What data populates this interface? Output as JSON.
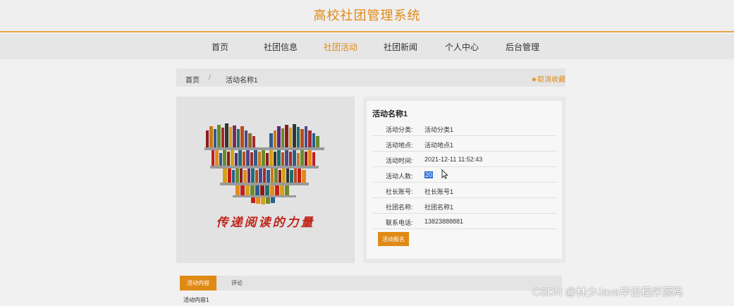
{
  "header": {
    "site_title": "高校社团管理系统"
  },
  "nav": [
    {
      "label": "首页"
    },
    {
      "label": "社团信息"
    },
    {
      "label": "社团活动"
    },
    {
      "label": "社团新闻"
    },
    {
      "label": "个人中心"
    },
    {
      "label": "后台管理"
    }
  ],
  "nav_active": "社团活动",
  "breadcrumb": {
    "home": "首页",
    "separator": "/",
    "current": "活动名称1"
  },
  "favorite": {
    "label": "取消收藏",
    "icon": "star-icon"
  },
  "image": {
    "slogan": "传递阅读的力量"
  },
  "activity": {
    "title": "活动名称1",
    "fields": [
      {
        "label": "活动分类:",
        "value": "活动分类1"
      },
      {
        "label": "活动地点:",
        "value": "活动地点1"
      },
      {
        "label": "活动时间:",
        "value": "2021-12-11 11:52:43"
      },
      {
        "label": "活动人数:",
        "value": "20"
      },
      {
        "label": "社长账号:",
        "value": "社长账号1"
      },
      {
        "label": "社团名称:",
        "value": "社团名称1"
      },
      {
        "label": "联系电话:",
        "value": "13823888881"
      }
    ],
    "signup_label": "活动报名"
  },
  "tabs": [
    {
      "label": "活动内容"
    },
    {
      "label": "评论"
    }
  ],
  "content": {
    "text": "活动内容1"
  },
  "watermark": "CSDN @林少Java毕设程序源码",
  "colors": {
    "accent": "#e08a16",
    "selection": "#2f6fd6",
    "slogan": "#c0241b"
  }
}
